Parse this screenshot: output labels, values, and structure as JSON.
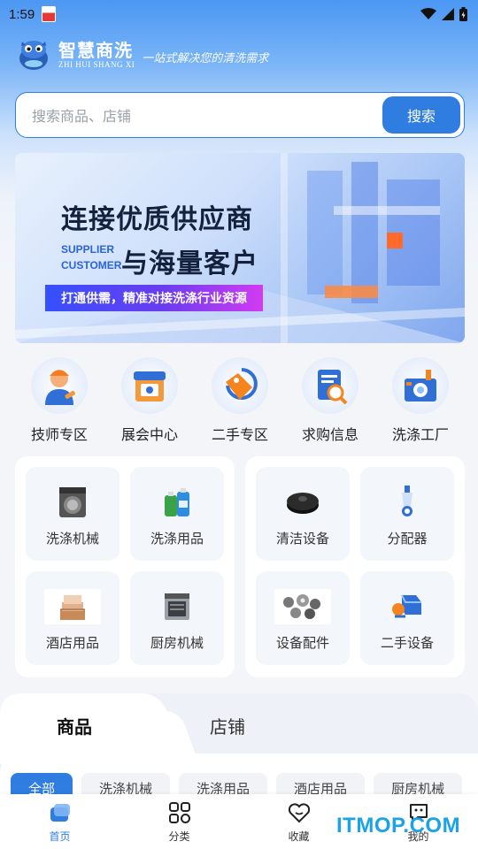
{
  "status_bar": {
    "time": "1:59"
  },
  "brand": {
    "title": "智慧商洗",
    "pinyin": "ZHI HUI SHANG XI",
    "slogan": "一站式解决您的清洗需求"
  },
  "search": {
    "placeholder": "搜索商品、店铺",
    "button": "搜索"
  },
  "banner": {
    "headline": "连接优质供应商",
    "en_line1": "SUPPLIER",
    "en_line2": "CUSTOMER",
    "headline2": "与海量客户",
    "strip": "打通供需，精准对接洗涤行业资源"
  },
  "quick_entries": [
    {
      "label": "技师专区",
      "icon": "technician-icon"
    },
    {
      "label": "展会中心",
      "icon": "exhibition-icon"
    },
    {
      "label": "二手专区",
      "icon": "secondhand-tag-icon"
    },
    {
      "label": "求购信息",
      "icon": "purchase-request-icon"
    },
    {
      "label": "洗涤工厂",
      "icon": "laundry-factory-icon"
    }
  ],
  "categories_left": [
    {
      "label": "洗涤机械",
      "icon": "washing-machine-icon"
    },
    {
      "label": "洗涤用品",
      "icon": "detergent-icon"
    },
    {
      "label": "酒店用品",
      "icon": "hotel-linen-icon"
    },
    {
      "label": "厨房机械",
      "icon": "dishwasher-icon"
    }
  ],
  "categories_right": [
    {
      "label": "清洁设备",
      "icon": "robot-cleaner-icon"
    },
    {
      "label": "分配器",
      "icon": "dispenser-icon"
    },
    {
      "label": "设备配件",
      "icon": "parts-icon"
    },
    {
      "label": "二手设备",
      "icon": "secondhand-box-icon"
    }
  ],
  "tabs": {
    "products": "商品",
    "shops": "店铺"
  },
  "filters": [
    "全部",
    "洗涤机械",
    "洗涤用品",
    "酒店用品",
    "厨房机械"
  ],
  "bottom_nav": [
    {
      "label": "首页",
      "icon": "home-icon"
    },
    {
      "label": "分类",
      "icon": "category-grid-icon"
    },
    {
      "label": "收藏",
      "icon": "heart-icon"
    },
    {
      "label": "我的",
      "icon": "profile-icon"
    }
  ],
  "watermark": "ITMOP.COM",
  "colors": {
    "primary": "#2f7de0",
    "banner_strip": "#3550ff"
  }
}
